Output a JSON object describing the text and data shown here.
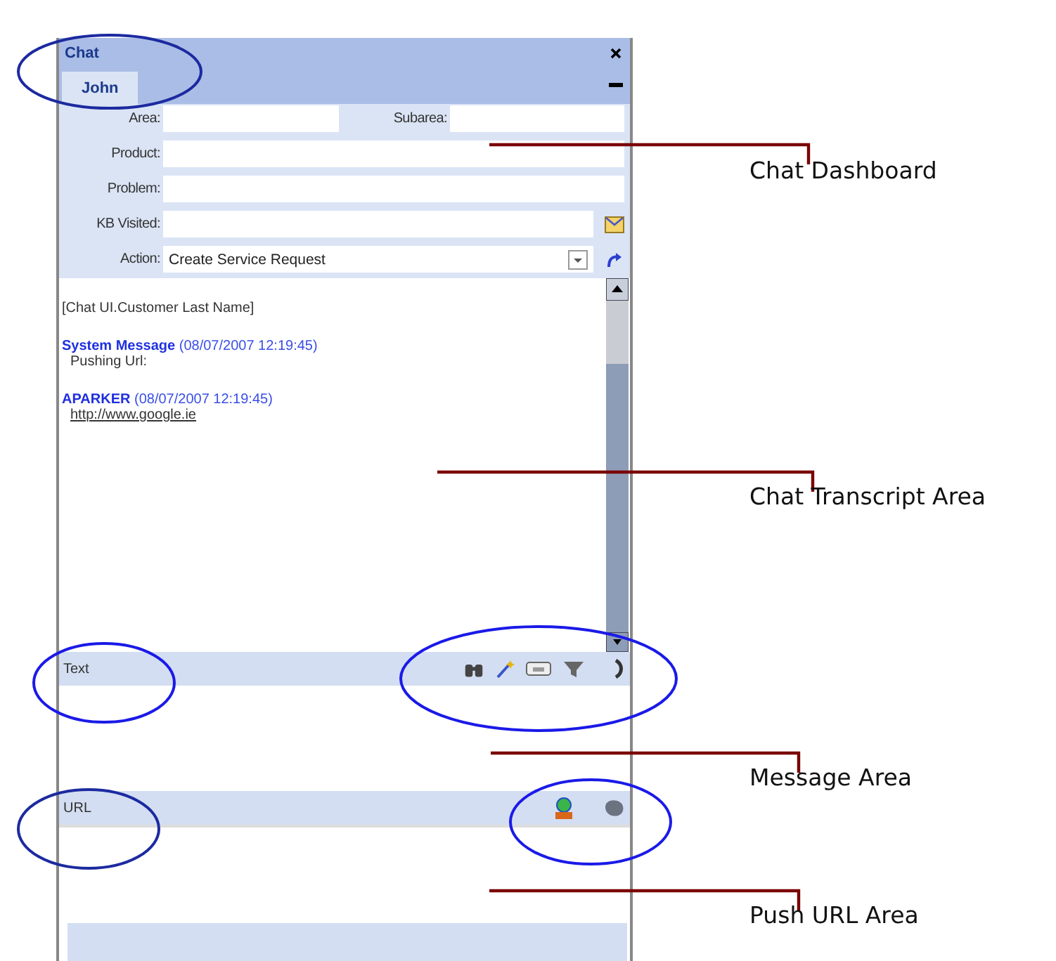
{
  "window": {
    "title": "Chat",
    "tabs": [
      {
        "label": "John",
        "selected": true
      }
    ]
  },
  "dashboard": {
    "rows": [
      {
        "fields": [
          {
            "label": "Area:",
            "kind": "text"
          },
          {
            "label": "Subarea:",
            "kind": "text"
          }
        ]
      },
      {
        "fields": [
          {
            "label": "Product:",
            "kind": "text"
          }
        ]
      },
      {
        "fields": [
          {
            "label": "Problem:",
            "kind": "text"
          }
        ]
      },
      {
        "fields": [
          {
            "label": "KB Visited:",
            "kind": "mail"
          }
        ]
      },
      {
        "fields": [
          {
            "label": "Action:",
            "kind": "dropdown",
            "value": "Create Service Request"
          }
        ]
      }
    ]
  },
  "transcript": {
    "heading": "[Chat UI.Customer Last Name]",
    "messages": [
      {
        "sender": "System Message",
        "time": "(08/07/2007 12:19:45)",
        "body": "Pushing Url:",
        "kind": "text"
      },
      {
        "sender": "APARKER",
        "time": "(08/07/2007 12:19:45)",
        "body": "http://www.google.ie",
        "kind": "link"
      }
    ]
  },
  "text_bar": {
    "label": "Text"
  },
  "url_bar": {
    "label": "URL"
  },
  "callouts": [
    {
      "label": "Chat Dashboard"
    },
    {
      "label": "Chat Transcript Area"
    },
    {
      "label": "Message Area"
    },
    {
      "label": "Push URL Area"
    }
  ]
}
